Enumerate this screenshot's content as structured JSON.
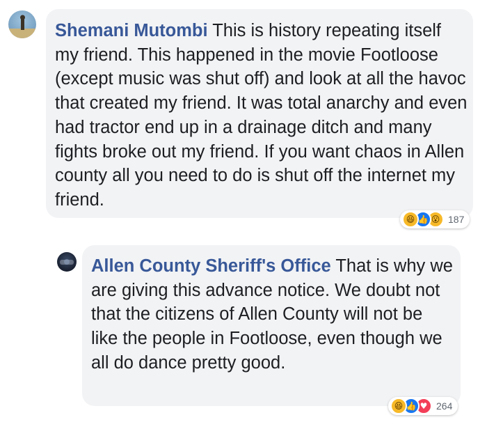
{
  "comments": [
    {
      "author": "Shemani Mutombi",
      "text": "This is history repeating itself my friend. This happened in the movie Footloose (except music was shut off) and look at all the havoc that created my friend. It was total anarchy and even had tractor end up in a drainage ditch and many fights broke out my friend. If you want chaos in Allen county all you need to do is shut off the internet my friend.",
      "reaction_count": "187",
      "reactions": [
        {
          "name": "haha-reaction-icon",
          "glyph": "😆"
        },
        {
          "name": "like-reaction-icon",
          "glyph": "👍"
        },
        {
          "name": "wow-reaction-icon",
          "glyph": "😮"
        }
      ]
    },
    {
      "author": "Allen County Sheriff's Office",
      "text": "That is why we are giving this advance notice. We doubt not that the citizens of Allen County will not be like the people in Footloose, even though we all do dance pretty good.",
      "reaction_count": "264",
      "reactions": [
        {
          "name": "haha-reaction-icon",
          "glyph": "😆"
        },
        {
          "name": "like-reaction-icon",
          "glyph": "👍"
        },
        {
          "name": "love-reaction-icon",
          "glyph": "♥"
        }
      ]
    }
  ],
  "colors": {
    "author_link": "#385898",
    "bubble_bg": "#f2f3f5",
    "text": "#1c1e21",
    "like_blue": "#1877f2",
    "haha_yellow": "#f7b928",
    "love_red": "#f33e58"
  }
}
